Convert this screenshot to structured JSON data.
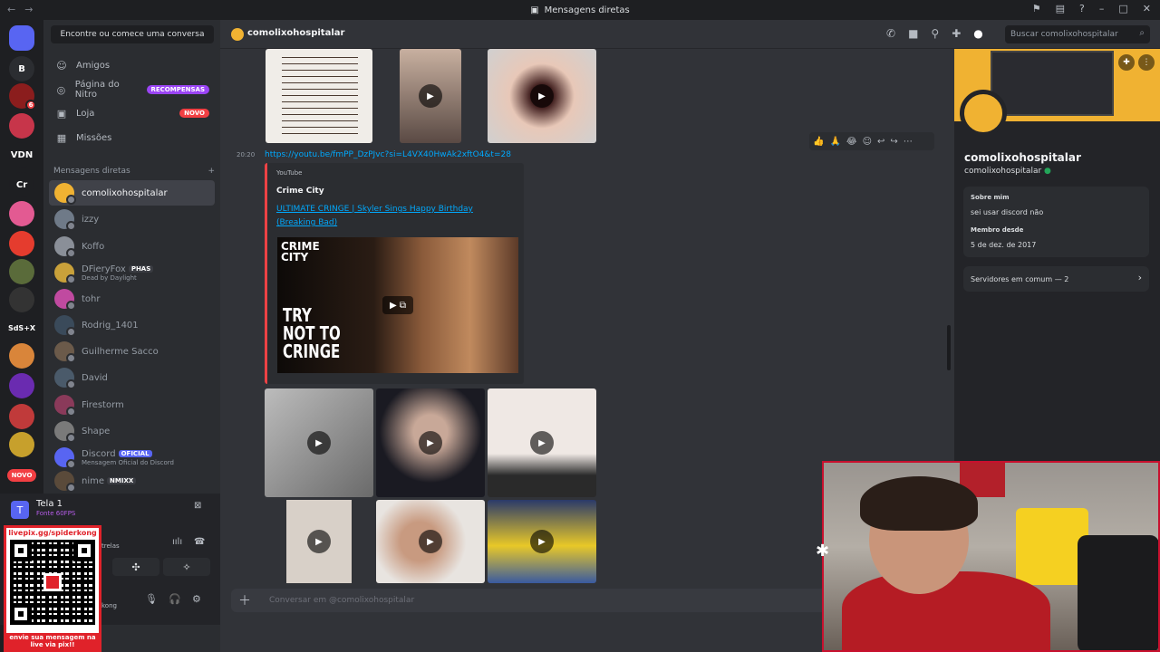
{
  "window": {
    "title": "Mensagens diretas"
  },
  "rail": {
    "items": [
      {
        "label": "",
        "color": "#5865f2",
        "icon": "discord-logo-icon"
      },
      {
        "label": "B",
        "color": "#2b2d31"
      },
      {
        "label": "",
        "color": "#8b1d1d",
        "badge": "6"
      },
      {
        "label": "",
        "color": "#c7354a"
      },
      {
        "label": "VDN",
        "color": "#1e1f22"
      },
      {
        "label": "Cr",
        "color": "#1e1f22"
      },
      {
        "label": "",
        "color": "#e35a92"
      },
      {
        "label": "",
        "color": "#e53c2e"
      },
      {
        "label": "",
        "color": "#5a6b3a"
      },
      {
        "label": "",
        "color": "#333333"
      },
      {
        "label": "SdS+X",
        "color": "#1e1f22"
      },
      {
        "label": "",
        "color": "#d9853a"
      },
      {
        "label": "",
        "color": "#6a2bb0"
      },
      {
        "label": "",
        "color": "#c03a3a"
      },
      {
        "label": "",
        "color": "#c7a02c"
      }
    ],
    "novo": "NOVO"
  },
  "dm_sidebar": {
    "search_placeholder": "Encontre ou comece uma conversa",
    "nav": [
      {
        "label": "Amigos",
        "icon": "friends-icon"
      },
      {
        "label": "Página do Nitro",
        "icon": "nitro-icon",
        "pill": "RECOMPENSAS",
        "pill_color": "#9b44f5"
      },
      {
        "label": "Loja",
        "icon": "shop-icon",
        "pill": "NOVO",
        "pill_color": "#f23f43"
      },
      {
        "label": "Missões",
        "icon": "quests-icon"
      }
    ],
    "section_title": "Mensagens diretas",
    "add": "+",
    "dms": [
      {
        "name": "comolixohospitalar",
        "color": "#f0b232",
        "active": true
      },
      {
        "name": "izzy",
        "color": "#6f7a88"
      },
      {
        "name": "Koffo",
        "color": "#8a8f98"
      },
      {
        "name": "DFieryFox",
        "color": "#c9a13a",
        "tag": "PHAS",
        "sub": "Dead by Daylight"
      },
      {
        "name": "tohr",
        "color": "#c04aa0"
      },
      {
        "name": "Rodrig_1401",
        "color": "#3a4a5a"
      },
      {
        "name": "Guilherme Sacco",
        "color": "#6b5a4a"
      },
      {
        "name": "David",
        "color": "#4a5a6a"
      },
      {
        "name": "Firestorm",
        "color": "#8a3a5a"
      },
      {
        "name": "Shape",
        "color": "#7a7a7a"
      },
      {
        "name": "Discord",
        "color": "#5865f2",
        "tag": "OFICIAL",
        "sub": "Mensagem Oficial do Discord"
      },
      {
        "name": "nime",
        "color": "#5a4a3a",
        "tag": "NMIXX"
      }
    ]
  },
  "stream": {
    "title": "Tela 1",
    "sub": "Fonte 60FPS",
    "partial1": "trelas",
    "partial2": "kong"
  },
  "qr": {
    "top": "livepix.gg/spiderkong",
    "bottom": "envie sua mensagem na live via pix!!"
  },
  "chat": {
    "channel_name": "comolixohospitalar",
    "search_placeholder": "Buscar comolixohospitalar",
    "timestamp": "20:20",
    "link": "https://youtu.be/fmPP_DzPJvc?si=L4VX40HwAk2xftO4&t=28",
    "embed": {
      "provider": "YouTube",
      "author": "Crime City",
      "title": "ULTIMATE CRINGE | Skyler Sings Happy Birthday (Breaking Bad)",
      "logo": "CRIME CITY",
      "overlay": "TRY NOT TO CRINGE"
    },
    "reactions": [
      "👍",
      "🙏",
      "😂"
    ],
    "composer_placeholder": "Conversar em @comolixohospitalar"
  },
  "profile": {
    "display_name": "comolixohospitalar",
    "username": "comolixohospitalar",
    "about_label": "Sobre mim",
    "about": "sei usar discord não",
    "member_label": "Membro desde",
    "member_since": "5 de dez. de 2017",
    "mutual": "Servidores em comum — 2"
  }
}
